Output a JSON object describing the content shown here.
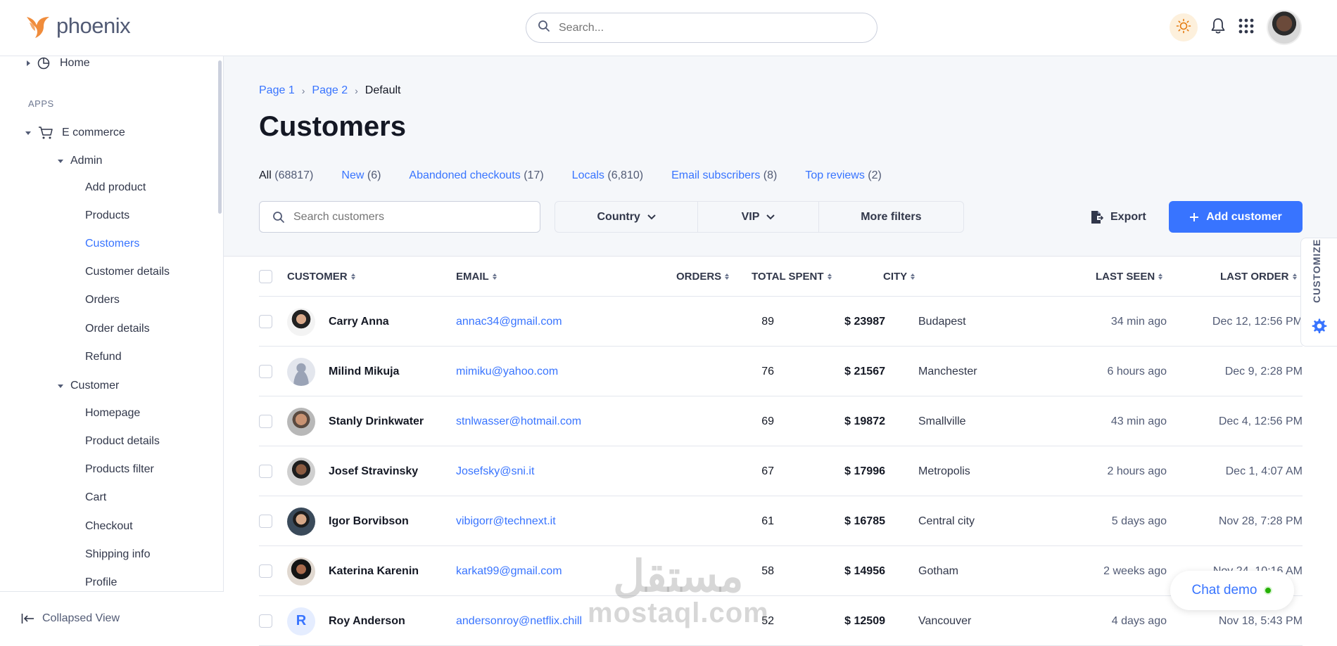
{
  "app": {
    "logo_text": "phoenix"
  },
  "topbar": {
    "search_placeholder": "Search..."
  },
  "sidebar": {
    "home": "Home",
    "section_apps": "APPS",
    "ecommerce": "E commerce",
    "admin": "Admin",
    "admin_items": [
      "Add product",
      "Products",
      "Customers",
      "Customer details",
      "Orders",
      "Order details",
      "Refund"
    ],
    "customer": "Customer",
    "customer_items": [
      "Homepage",
      "Product details",
      "Products filter",
      "Cart",
      "Checkout",
      "Shipping info",
      "Profile"
    ],
    "collapsed_view": "Collapsed View",
    "active_item": "Customers"
  },
  "breadcrumb": {
    "page1": "Page 1",
    "page2": "Page 2",
    "current": "Default"
  },
  "page_title": "Customers",
  "filter_tabs": [
    {
      "label": "All",
      "count": "(68817)"
    },
    {
      "label": "New",
      "count": "(6)"
    },
    {
      "label": "Abandoned checkouts",
      "count": "(17)"
    },
    {
      "label": "Locals",
      "count": "(6,810)"
    },
    {
      "label": "Email subscribers",
      "count": "(8)"
    },
    {
      "label": "Top reviews",
      "count": "(2)"
    }
  ],
  "toolbar": {
    "search_placeholder": "Search customers",
    "country": "Country",
    "vip": "VIP",
    "more_filters": "More filters",
    "export": "Export",
    "add_customer": "Add customer"
  },
  "table": {
    "headers": {
      "customer": "CUSTOMER",
      "email": "EMAIL",
      "orders": "ORDERS",
      "total_spent": "TOTAL SPENT",
      "city": "CITY",
      "last_seen": "LAST SEEN",
      "last_order": "LAST ORDER"
    },
    "rows": [
      {
        "name": "Carry Anna",
        "email": "annac34@gmail.com",
        "orders": "89",
        "spent": "$ 23987",
        "city": "Budapest",
        "last_seen": "34 min ago",
        "last_order": "Dec 12, 12:56 PM"
      },
      {
        "name": "Milind Mikuja",
        "email": "mimiku@yahoo.com",
        "orders": "76",
        "spent": "$ 21567",
        "city": "Manchester",
        "last_seen": "6 hours ago",
        "last_order": "Dec 9, 2:28 PM"
      },
      {
        "name": "Stanly Drinkwater",
        "email": "stnlwasser@hotmail.com",
        "orders": "69",
        "spent": "$ 19872",
        "city": "Smallville",
        "last_seen": "43 min ago",
        "last_order": "Dec 4, 12:56 PM"
      },
      {
        "name": "Josef Stravinsky",
        "email": "Josefsky@sni.it",
        "orders": "67",
        "spent": "$ 17996",
        "city": "Metropolis",
        "last_seen": "2 hours ago",
        "last_order": "Dec 1, 4:07 AM"
      },
      {
        "name": "Igor Borvibson",
        "email": "vibigorr@technext.it",
        "orders": "61",
        "spent": "$ 16785",
        "city": "Central city",
        "last_seen": "5 days ago",
        "last_order": "Nov 28, 7:28 PM"
      },
      {
        "name": "Katerina Karenin",
        "email": "karkat99@gmail.com",
        "orders": "58",
        "spent": "$ 14956",
        "city": "Gotham",
        "last_seen": "2 weeks ago",
        "last_order": "Nov 24, 10:16 AM"
      },
      {
        "name": "Roy Anderson",
        "email": "andersonroy@netflix.chill",
        "orders": "52",
        "spent": "$ 12509",
        "city": "Vancouver",
        "last_seen": "4 days ago",
        "last_order": "Nov 18, 5:43 PM",
        "initial": "R"
      }
    ]
  },
  "customize": {
    "label": "CUSTOMIZE"
  },
  "chat": {
    "label": "Chat demo"
  },
  "watermark": {
    "line1": "مستقل",
    "line2": "mostaql.com"
  },
  "colors": {
    "primary": "#3874ff",
    "text": "#141824",
    "muted": "#525b75",
    "border": "#e3e6ed",
    "bg": "#f5f7fa",
    "online": "#25b003",
    "logo_orange": "#f08c3b"
  }
}
